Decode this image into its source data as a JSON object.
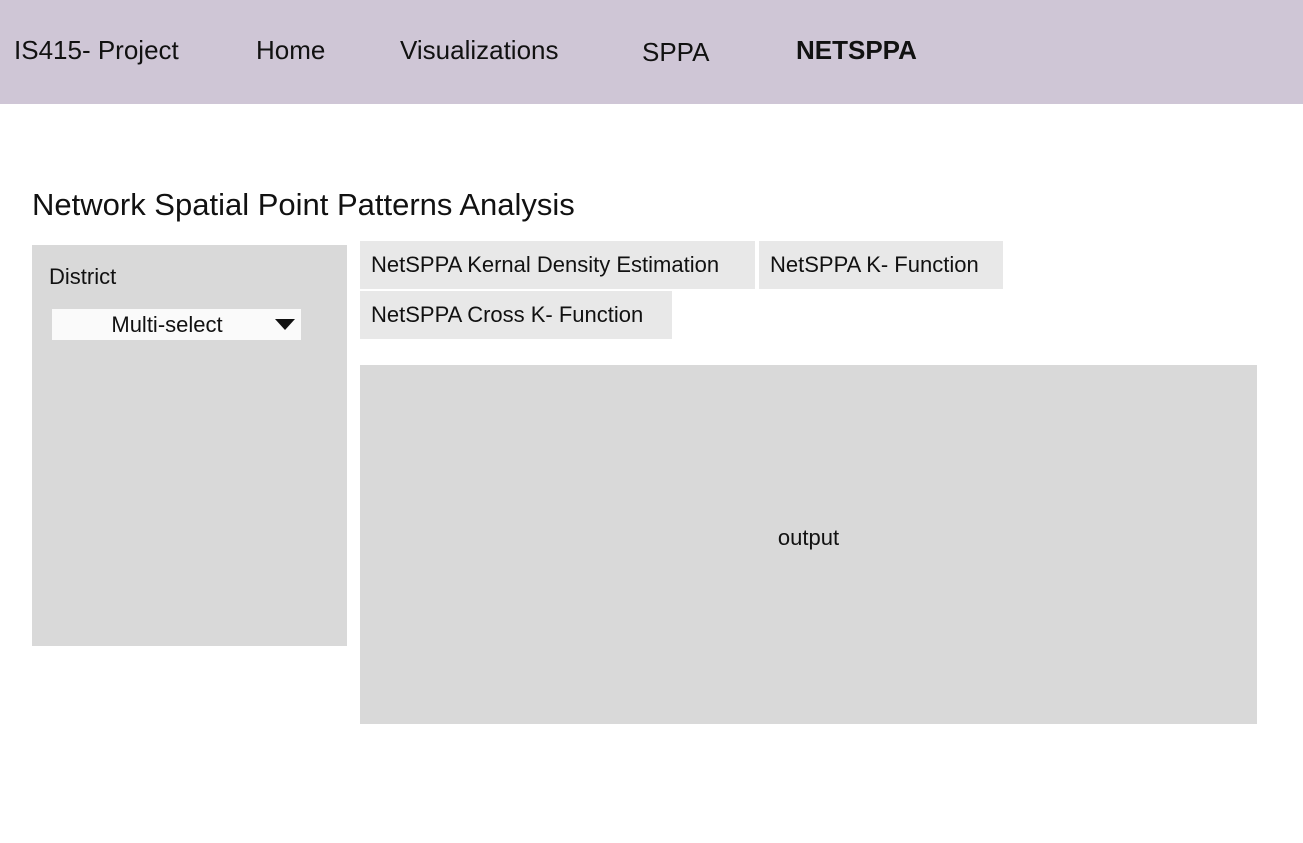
{
  "navbar": {
    "brand": "IS415- Project",
    "items": [
      {
        "label": "Home"
      },
      {
        "label": "Visualizations"
      },
      {
        "label": "SPPA"
      },
      {
        "label": "NETSPPA",
        "active": true
      }
    ],
    "background": "#cfc6d6"
  },
  "page": {
    "title": "Network Spatial Point Patterns Analysis"
  },
  "sidebar": {
    "district_label": "District",
    "multiselect": {
      "value": "Multi-select"
    }
  },
  "tabs": [
    {
      "label": "NetSPPA Kernal Density Estimation"
    },
    {
      "label": "NetSPPA K- Function"
    },
    {
      "label": "NetSPPA Cross K- Function"
    }
  ],
  "output": {
    "label": "output"
  },
  "colors": {
    "panel": "#d9d9d9",
    "tab": "#e8e8e8",
    "input": "#fafafa"
  },
  "icons": {
    "multiselect_caret": "caret-down-icon"
  }
}
